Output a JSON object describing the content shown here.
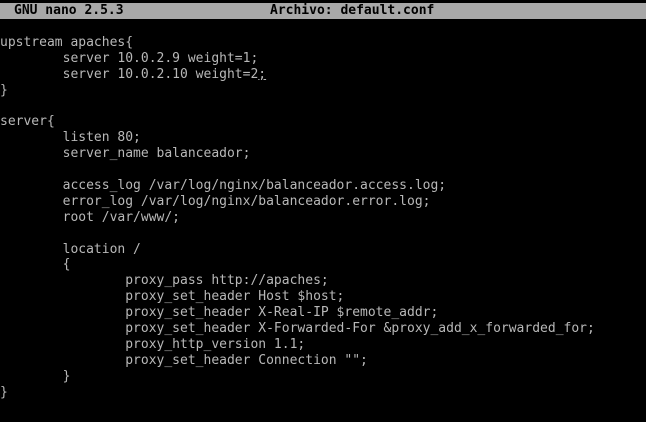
{
  "titlebar": {
    "app": "GNU nano 2.5.3",
    "file": "Archivo: default.conf"
  },
  "editor": {
    "lines": [
      "upstream apaches{",
      "        server 10.0.2.9 weight=1;",
      "        server 10.0.2.10 weight=2;",
      "}",
      "",
      "server{",
      "        listen 80;",
      "        server_name balanceador;",
      "",
      "        access_log /var/log/nginx/balanceador.access.log;",
      "        error_log /var/log/nginx/balanceador.error.log;",
      "        root /var/www/;",
      "",
      "        location /",
      "        {",
      "                proxy_pass http://apaches;",
      "                proxy_set_header Host $host;",
      "                proxy_set_header X-Real-IP $remote_addr;",
      "                proxy_set_header X-Forwarded-For &proxy_add_x_forwarded_for;",
      "                proxy_http_version 1.1;",
      "                proxy_set_header Connection \"\";",
      "        }",
      "}"
    ]
  }
}
